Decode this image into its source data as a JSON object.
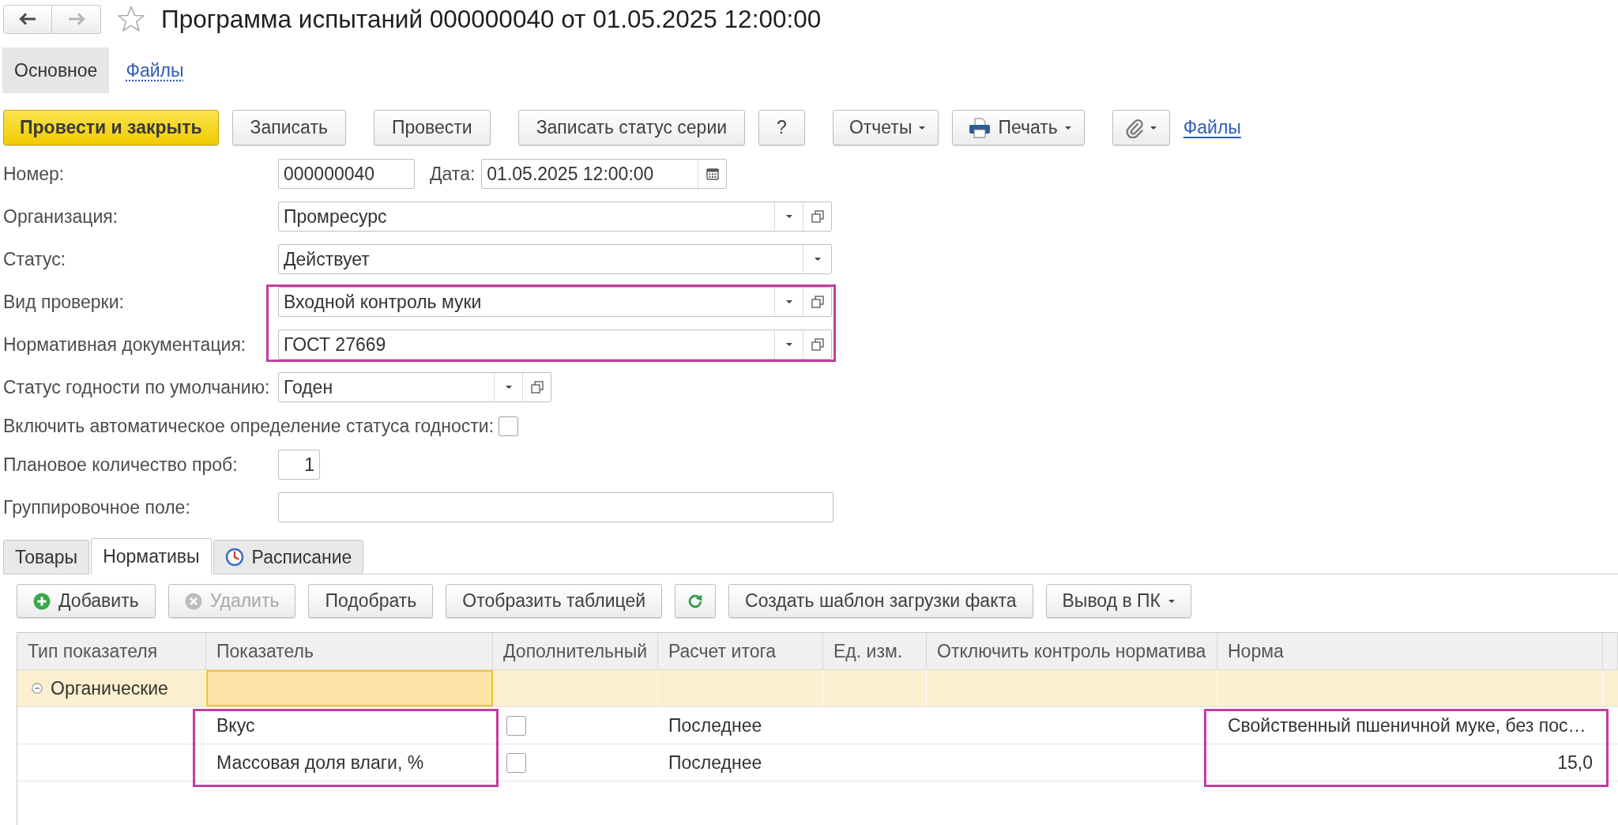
{
  "window": {
    "title": "Программа испытаний 000000040 от 01.05.2025 12:00:00",
    "favorite": false,
    "navigation": [
      {
        "kind": "back",
        "disabled": false
      },
      {
        "kind": "forward",
        "disabled": true
      }
    ]
  },
  "section_tabs": [
    {
      "label": "Основное",
      "selected": true
    },
    {
      "label": "Файлы",
      "selected": false
    }
  ],
  "command_groups": [
    [
      {
        "kind": "primary",
        "label": "Провести и закрыть"
      },
      {
        "kind": "button",
        "label": "Записать"
      }
    ],
    [
      {
        "kind": "button",
        "label": "Провести"
      }
    ],
    [
      {
        "kind": "button",
        "label": "Записать статус серии"
      },
      {
        "kind": "button",
        "label": "?"
      }
    ],
    [
      {
        "kind": "menu",
        "label": "Отчеты"
      },
      {
        "kind": "print",
        "label": "Печать"
      }
    ],
    [
      {
        "kind": "attach"
      },
      {
        "kind": "link",
        "label": "Файлы"
      }
    ]
  ],
  "form": {
    "fields": [
      {
        "kind": "docnumber",
        "label": "Номер:",
        "value": "000000040",
        "date_label": "Дата:",
        "date_value": "01.05.2025 12:00:00",
        "highlighted": false
      },
      {
        "kind": "reference",
        "label": "Организация:",
        "value": "Промресурс",
        "highlighted": false
      },
      {
        "kind": "choice",
        "label": "Статус:",
        "value": "Действует",
        "highlighted": false
      },
      {
        "kind": "reference",
        "label": "Вид проверки:",
        "value": "Входной контроль муки",
        "highlighted": true
      },
      {
        "kind": "reference",
        "label": "Нормативная документация:",
        "value": "ГОСТ 27669",
        "highlighted": true
      },
      {
        "kind": "compact",
        "label": "Статус годности по умолчанию:",
        "value": "Годен",
        "highlighted": false
      },
      {
        "kind": "checkbox",
        "label": "Включить автоматическое определение статуса годности:",
        "checked": false,
        "highlighted": false
      },
      {
        "kind": "quantity",
        "label": "Плановое количество проб:",
        "value": "1",
        "highlighted": false
      },
      {
        "kind": "text",
        "label": "Группировочное поле:",
        "highlighted": false
      }
    ]
  },
  "tabs": [
    {
      "kind": "plain",
      "label": "Товары",
      "selected": false
    },
    {
      "kind": "plain",
      "label": "Нормативы",
      "selected": true
    },
    {
      "kind": "schedule",
      "label": "Расписание",
      "selected": false
    }
  ],
  "table_toolbar": [
    {
      "kind": "add",
      "label": "Добавить",
      "disabled": false
    },
    {
      "kind": "delete",
      "label": "Удалить",
      "disabled": true
    },
    {
      "kind": "button",
      "label": "Подобрать",
      "disabled": false
    },
    {
      "kind": "button",
      "label": "Отобразить таблицей",
      "disabled": false
    },
    {
      "kind": "refresh",
      "disabled": false
    },
    {
      "kind": "button",
      "label": "Создать шаблон загрузки факта",
      "disabled": false
    },
    {
      "kind": "menu",
      "label": "Вывод в ПК",
      "disabled": false
    }
  ],
  "table": {
    "columns": [
      {
        "title": "Тип показателя",
        "focused": false
      },
      {
        "title": "Показатель",
        "focused": true
      },
      {
        "title": "Дополнительный",
        "focused": false
      },
      {
        "title": "Расчет итога",
        "focused": false
      },
      {
        "title": "Ед. изм.",
        "focused": false
      },
      {
        "title": "Отключить контроль норматива",
        "focused": false
      },
      {
        "title": "Норма",
        "focused": false
      }
    ],
    "rows": [
      {
        "group": "Органические",
        "expanded": true,
        "selected": true,
        "children": [
          {
            "indicator": {
              "text": "Вкус",
              "highlighted": true
            },
            "additional": false,
            "total": {
              "text": "Последнее",
              "highlighted": false
            },
            "norm": {
              "kind": "text",
              "text": "Свойственный пшеничной муке, без пос…",
              "highlighted": true
            },
            "selected": false
          },
          {
            "indicator": {
              "text": "Массовая доля влаги, %",
              "highlighted": true
            },
            "additional": false,
            "total": {
              "text": "Последнее",
              "highlighted": false
            },
            "norm": {
              "kind": "number",
              "text": "15,0",
              "highlighted": true
            },
            "selected": false
          }
        ]
      }
    ]
  }
}
